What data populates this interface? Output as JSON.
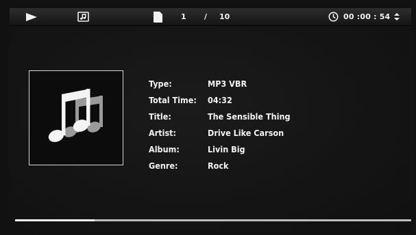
{
  "topbar": {
    "play_icon": "play-icon",
    "music_icon": "music-note-icon",
    "file_icon": "file-icon",
    "track_current": "1",
    "track_separator": "/",
    "track_total": "10",
    "clock_icon": "clock-icon",
    "elapsed_time": "00 :00 : 54",
    "arrows_icon": "up-down-arrows-icon"
  },
  "album_art": {
    "icon": "music-notes-icon"
  },
  "info": {
    "rows": [
      {
        "label": "Type:",
        "value": "MP3 VBR"
      },
      {
        "label": "Total Time:",
        "value": "04:32"
      },
      {
        "label": "Title:",
        "value": "The Sensible Thing"
      },
      {
        "label": "Artist:",
        "value": "Drive Like Carson"
      },
      {
        "label": "Album:",
        "value": "Livin Big"
      },
      {
        "label": "Genre:",
        "value": "Rock"
      }
    ]
  },
  "playback": {
    "progress_fraction": 0.2
  },
  "colors": {
    "text": "#f2f2f2",
    "background": "#111111",
    "topbar": "#262626"
  }
}
